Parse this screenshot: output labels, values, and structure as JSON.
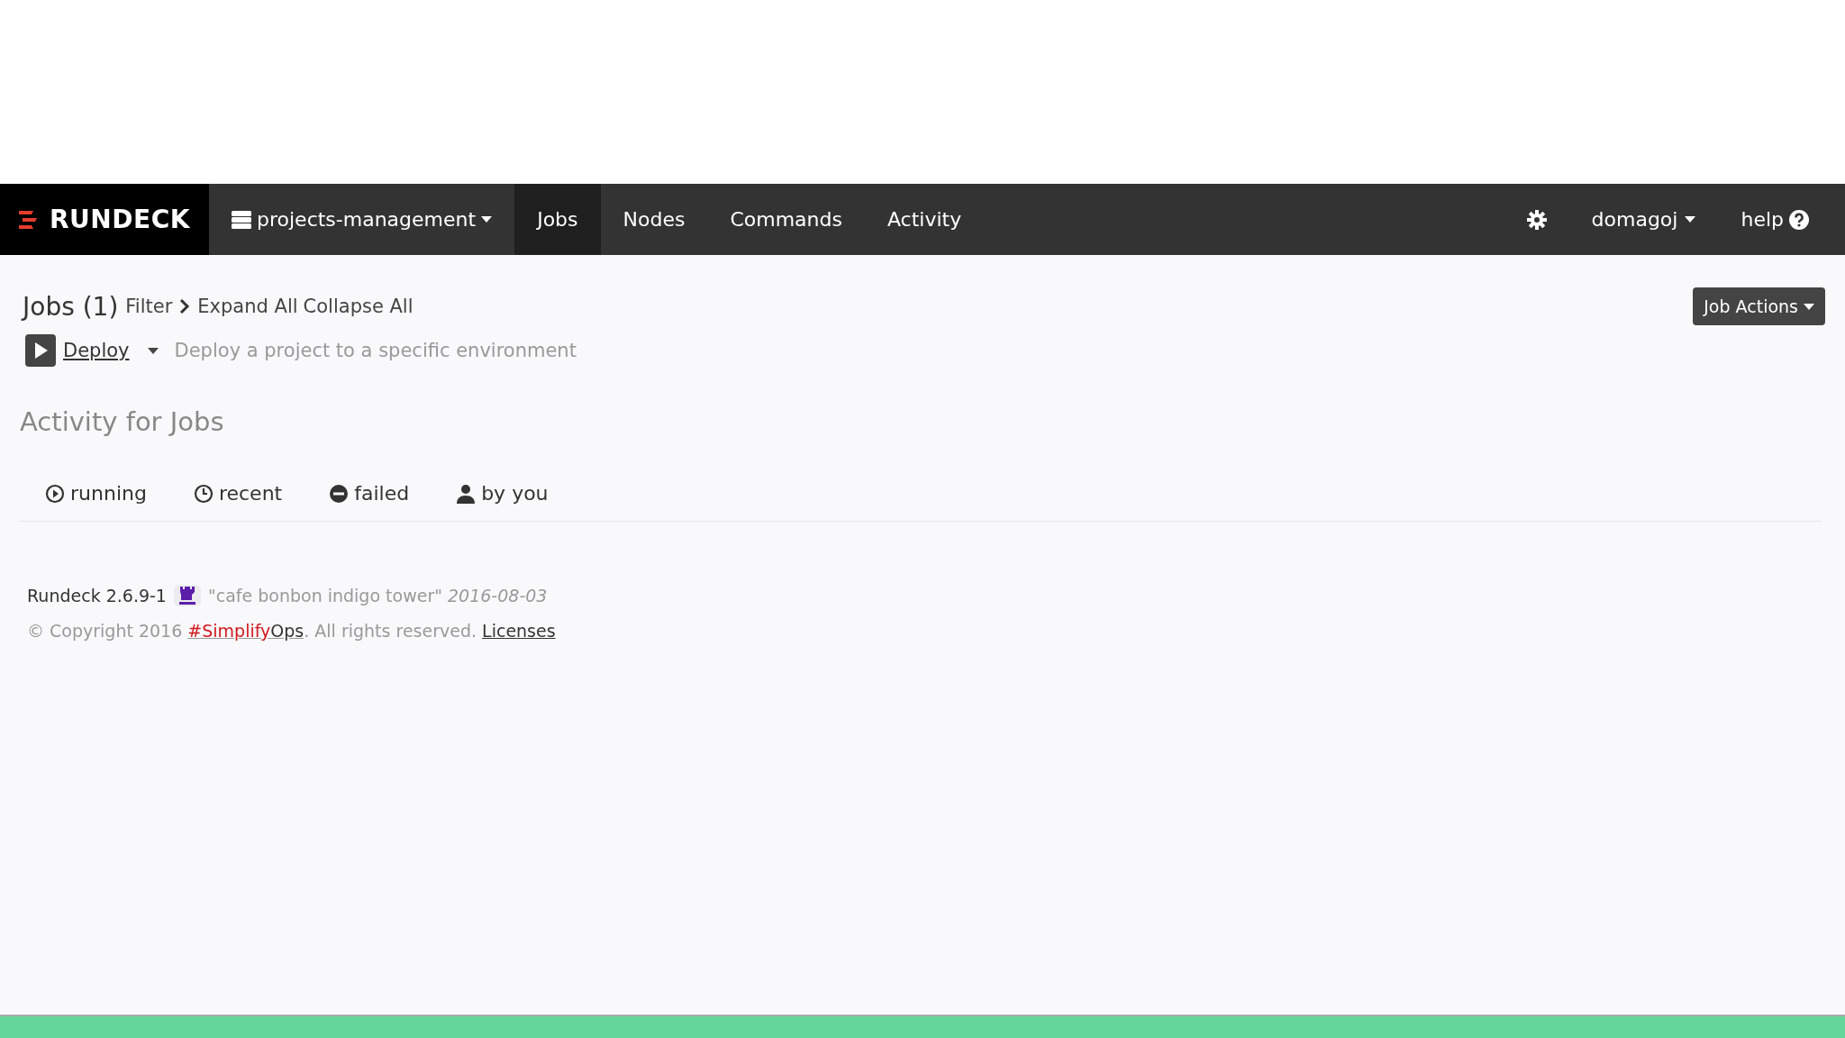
{
  "navbar": {
    "brand": "RUNDECK",
    "project": "projects-management",
    "items": [
      {
        "label": "Jobs",
        "selected": true
      },
      {
        "label": "Nodes",
        "selected": false
      },
      {
        "label": "Commands",
        "selected": false
      },
      {
        "label": "Activity",
        "selected": false
      }
    ],
    "user": "domagoj",
    "help": "help"
  },
  "jobs": {
    "title": "Jobs (1)",
    "filter": "Filter",
    "expand": "Expand All",
    "collapse": "Collapse All",
    "actions": "Job Actions",
    "list": [
      {
        "name": "Deploy",
        "description": "Deploy a project to a specific environment"
      }
    ]
  },
  "activity": {
    "title": "Activity for Jobs",
    "tabs": [
      {
        "kind": "running",
        "label": "running"
      },
      {
        "kind": "recent",
        "label": "recent"
      },
      {
        "kind": "failed",
        "label": "failed"
      },
      {
        "kind": "user",
        "label": "by you"
      }
    ]
  },
  "footer": {
    "version": "Rundeck 2.6.9-1",
    "codename": "\"cafe bonbon indigo tower\"",
    "date": "2016-08-03",
    "copyright": "© Copyright 2016",
    "link_red": "#Simplify",
    "link_rest": "Ops",
    "rights": ". All rights reserved.",
    "licenses": "Licenses"
  }
}
